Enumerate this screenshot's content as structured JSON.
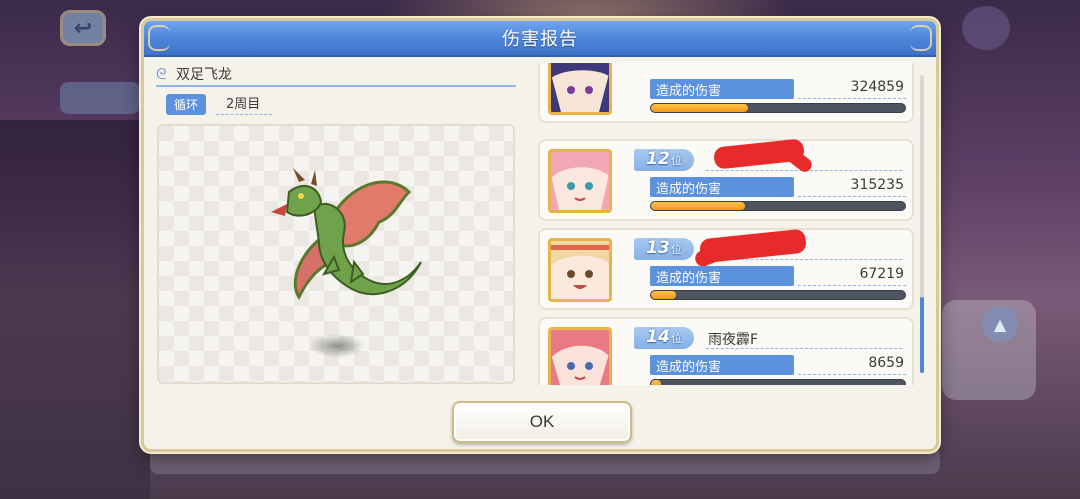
{
  "dialog": {
    "title": "伤害报告",
    "ok_label": "OK"
  },
  "boss": {
    "name": "双足飞龙",
    "cycle_label": "循环",
    "cycle_value": "2周目",
    "sprite_icon": "wyvern-icon"
  },
  "damage_report": {
    "damage_label": "造成的伤害",
    "entries": [
      {
        "rank": "",
        "rank_suffix": "",
        "name": "",
        "damage": "324859",
        "damage_fraction": 0.38,
        "hair_color": "#3c3a7a"
      },
      {
        "rank": "12",
        "rank_suffix": "位",
        "name": "",
        "damage": "315235",
        "damage_fraction": 0.37,
        "hair_color": "#f3a6b6",
        "name_redacted": true
      },
      {
        "rank": "13",
        "rank_suffix": "位",
        "name": "",
        "damage": "67219",
        "damage_fraction": 0.1,
        "hair_color": "#f2d6a2",
        "name_redacted": true
      },
      {
        "rank": "14",
        "rank_suffix": "位",
        "name": "雨夜霹F",
        "damage": "8659",
        "damage_fraction": 0.04,
        "hair_color": "#e87a86"
      }
    ]
  },
  "colors": {
    "accent_blue": "#5b91dd",
    "header_blue": "#4c83d8",
    "bar_fill": "#f29a17",
    "frame_gold": "#e8b34a"
  }
}
